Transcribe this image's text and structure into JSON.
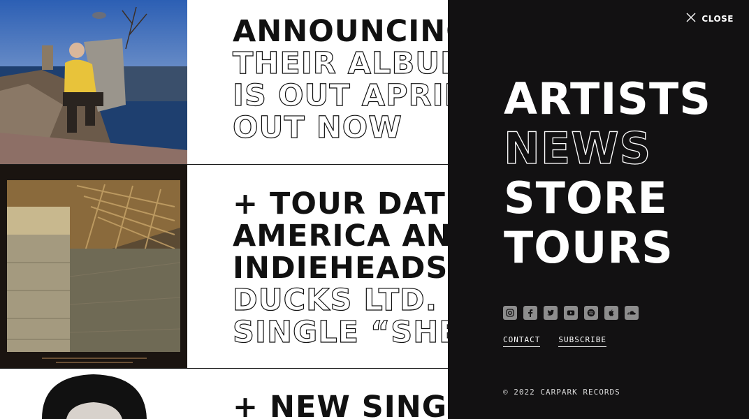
{
  "feed": {
    "stories": [
      {
        "lines_solid": [
          "ANNOUNCING"
        ],
        "lines_outline": [
          "THEIR ALBUM",
          "IS OUT APRIL",
          "OUT NOW"
        ]
      },
      {
        "lines_solid": [
          "+ TOUR DATES",
          "AMERICA AND",
          "INDIEHEADS A"
        ],
        "lines_outline": [
          "DUCKS LTD. RE",
          "SINGLE “SHEE"
        ]
      },
      {
        "lines_solid": [
          "+ NEW SINGLE"
        ],
        "lines_outline": []
      }
    ]
  },
  "menu": {
    "close_label": "CLOSE",
    "nav": [
      {
        "label": "ARTISTS",
        "style": "solid"
      },
      {
        "label": "NEWS",
        "style": "outline"
      },
      {
        "label": "STORE",
        "style": "solid"
      },
      {
        "label": "TOURS",
        "style": "solid"
      }
    ],
    "social_icons": [
      "instagram-icon",
      "facebook-icon",
      "twitter-icon",
      "youtube-icon",
      "spotify-icon",
      "apple-icon",
      "soundcloud-icon"
    ],
    "links": {
      "contact": "CONTACT",
      "subscribe": "SUBSCRIBE"
    },
    "copyright": "© 2022 CARPARK RECORDS"
  }
}
